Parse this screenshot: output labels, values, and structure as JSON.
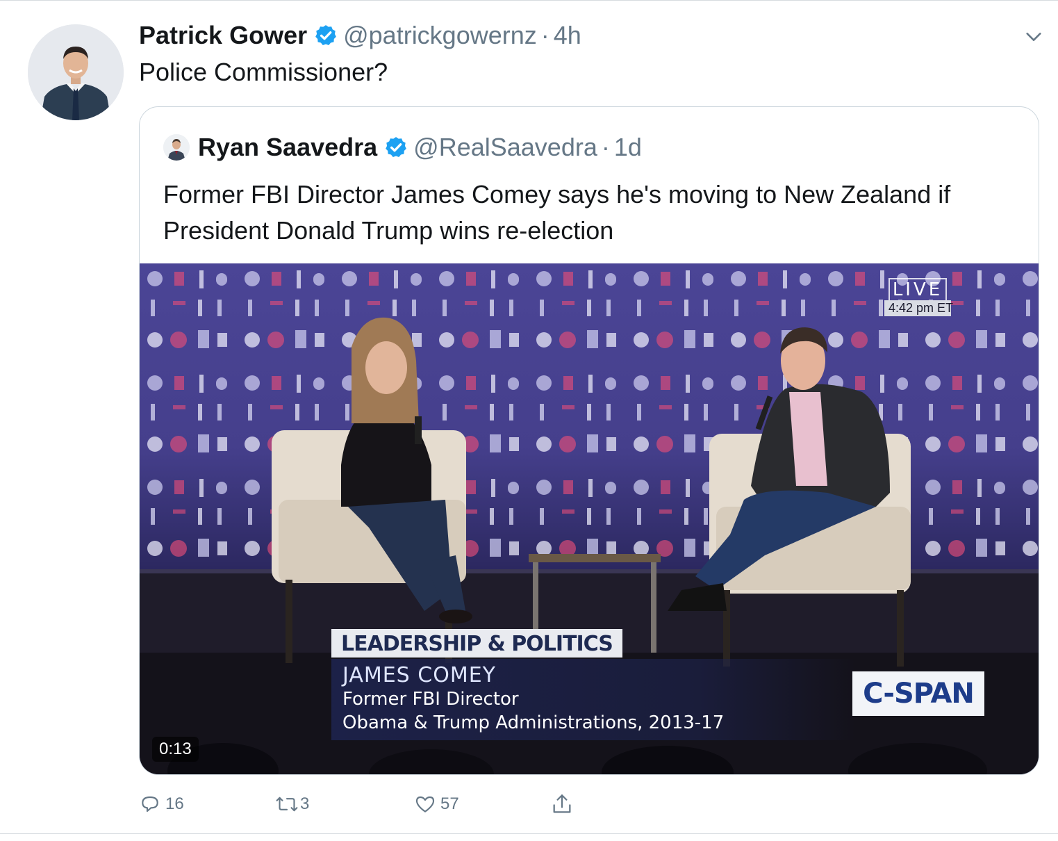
{
  "tweet": {
    "display_name": "Patrick Gower",
    "handle": "@patrickgowernz",
    "separator": "·",
    "time": "4h",
    "text": "Police Commissioner?"
  },
  "quoted_tweet": {
    "display_name": "Ryan Saavedra",
    "handle": "@RealSaavedra",
    "separator": "·",
    "time": "1d",
    "text": "Former FBI Director James Comey says he's moving to New Zealand if President Donald Trump wins re-election"
  },
  "video": {
    "duration": "0:13",
    "live_label": "LIVE",
    "live_time": "4:42 pm ET",
    "lower_third_title": "LEADERSHIP & POLITICS",
    "lower_third_name": "JAMES COMEY",
    "lower_third_line1": "Former FBI Director",
    "lower_third_line2": "Obama & Trump Administrations, 2013-17",
    "network_logo": "C-SPAN"
  },
  "actions": {
    "reply_count": "16",
    "retweet_count": "3",
    "like_count": "57"
  },
  "icons": {
    "verified": "verified-badge-icon",
    "more": "chevron-down-icon",
    "reply": "reply-icon",
    "retweet": "retweet-icon",
    "like": "heart-icon",
    "share": "share-icon"
  },
  "colors": {
    "verified_blue": "#1da1f2",
    "secondary_text": "#657786",
    "stage_backdrop": "#4a4594"
  }
}
